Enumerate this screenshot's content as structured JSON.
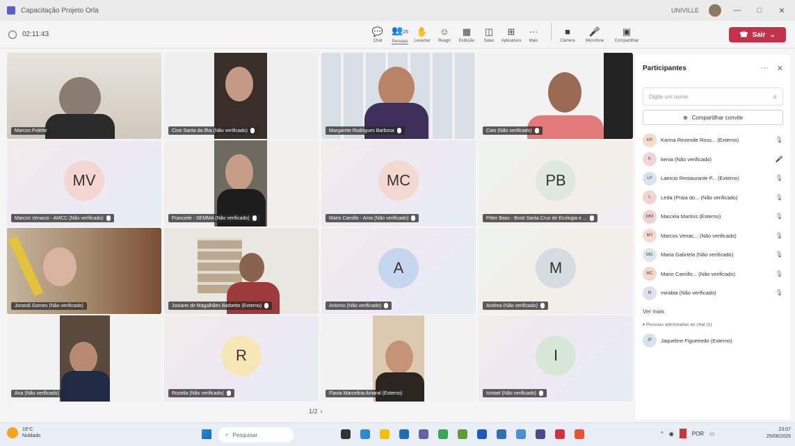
{
  "window": {
    "title": "Capacitação Projeto Orla",
    "org": "UNIVILLE",
    "controls": [
      "—",
      "□",
      "✕"
    ]
  },
  "toolbar": {
    "timer": "02:11:43",
    "tools": [
      {
        "label": "Chat",
        "icon": "chat-icon",
        "glyph": "💬"
      },
      {
        "label": "Pessoas",
        "icon": "people-icon",
        "glyph": "👥",
        "badge": "25"
      },
      {
        "label": "Levantar",
        "icon": "raise-hand-icon",
        "glyph": "✋"
      },
      {
        "label": "Reagir",
        "icon": "react-icon",
        "glyph": "☺"
      },
      {
        "label": "Exibição",
        "icon": "view-icon",
        "glyph": "▦"
      },
      {
        "label": "Salas",
        "icon": "rooms-icon",
        "glyph": "◫"
      },
      {
        "label": "Aplicativos",
        "icon": "apps-icon",
        "glyph": "⊞"
      },
      {
        "label": "Mais",
        "icon": "more-icon",
        "glyph": "···"
      }
    ],
    "media": [
      {
        "label": "Câmera",
        "icon": "camera-icon",
        "glyph": "■"
      },
      {
        "label": "Microfone",
        "icon": "microphone-icon",
        "glyph": "🎤"
      },
      {
        "label": "Compartilhar",
        "icon": "share-icon",
        "glyph": "▣"
      }
    ],
    "leave_label": "Sair"
  },
  "tiles": [
    {
      "name": "Marcos Polette",
      "type": "video"
    },
    {
      "name": "Cine Santa da Ilha (Não verificado)",
      "type": "video"
    },
    {
      "name": "Margarete Rodrigues Barbosa",
      "type": "video"
    },
    {
      "name": "Caio (Não verificado)",
      "type": "video"
    },
    {
      "name": "Marcos Venacio - AMCC (Não verificado)",
      "initials": "MV",
      "type": "avatar",
      "color": "#f6d6d2"
    },
    {
      "name": "Franciele - SEMMA (Não verificado)",
      "type": "video"
    },
    {
      "name": "Mario Camillo - Ama (Não verificado)",
      "initials": "MC",
      "type": "avatar",
      "color": "#f4d9d3"
    },
    {
      "name": "Pitter Bass - Bosti Santa Cruz de Ecologia e ...",
      "initials": "PB",
      "type": "avatar",
      "color": "#dfe9dd"
    },
    {
      "name": "Jorandi Gomes (Não verificado)",
      "type": "video"
    },
    {
      "name": "Josiane de Magalhães Barbetto (Externo)",
      "type": "video"
    },
    {
      "name": "Antonio (Não verificado)",
      "initials": "A",
      "type": "avatar",
      "color": "#c7d6ef"
    },
    {
      "name": "Andrea (Não verificado)",
      "initials": "M",
      "type": "avatar",
      "color": "#d5dde3"
    },
    {
      "name": "Ana (Não verificado)",
      "type": "video"
    },
    {
      "name": "Roselia (Não verificado)",
      "initials": "R",
      "type": "avatar",
      "color": "#f8e6b7"
    },
    {
      "name": "Flavia Marcelina Amaral (Externo)",
      "type": "video"
    },
    {
      "name": "Ismael (Não verificado)",
      "initials": "I",
      "type": "avatar",
      "color": "#d7e8d8"
    }
  ],
  "pager": {
    "text": "1/2",
    "next": "›"
  },
  "participants": {
    "title": "Participantes",
    "search_placeholder": "Digite um nome",
    "invite_label": "Compartilhar convite",
    "list": [
      {
        "initials": "KR",
        "name": "Karina Rezende Ross... (Externo)",
        "color": "#f7dccb"
      },
      {
        "initials": "K",
        "name": "kenia (Não verificado)",
        "color": "#f3d4d8"
      },
      {
        "initials": "LP",
        "name": "Laercio Restaurante P... (Externo)",
        "color": "#d9e2f0"
      },
      {
        "initials": "L",
        "name": "Leda (Praia do... (Não verificado)",
        "color": "#f4d3d3"
      },
      {
        "initials": "MM",
        "name": "Marcela Martins (Externo)",
        "color": "#f1d2d2"
      },
      {
        "initials": "MV",
        "name": "Marcos Venac... (Não verificado)",
        "color": "#f4dcd2"
      },
      {
        "initials": "MG",
        "name": "Maria Gabriela (Não verificado)",
        "color": "#dde6ef"
      },
      {
        "initials": "MC",
        "name": "Mario Camillo... (Não verificado)",
        "color": "#f3d8cf"
      },
      {
        "initials": "M",
        "name": "mirabia (Não verificado)",
        "color": "#e3def0"
      }
    ],
    "see_more": "Ver mais",
    "chat_section": "Pessoas adicionadas ao chat (1)",
    "chat_list": [
      {
        "initials": "JF",
        "name": "Jaqueline Figueiredo (Externo)",
        "color": "#d9e2f0"
      }
    ]
  },
  "taskbar": {
    "weather_temp": "19°C",
    "weather_desc": "Nublado",
    "search_label": "Pesquisar",
    "lang": "POR",
    "time": "23:07",
    "date": "25/06/2025"
  }
}
